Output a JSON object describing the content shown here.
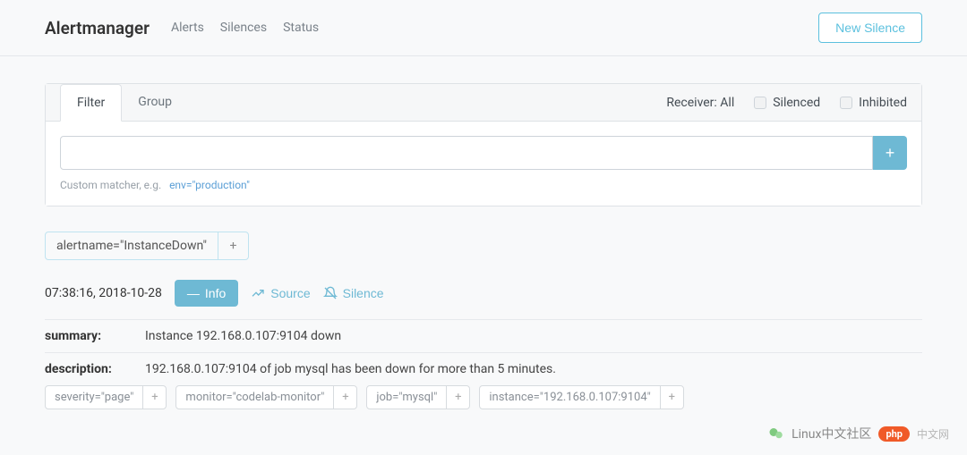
{
  "header": {
    "brand": "Alertmanager",
    "nav": {
      "alerts": "Alerts",
      "silences": "Silences",
      "status": "Status"
    },
    "new_silence": "New Silence"
  },
  "filter_card": {
    "tabs": {
      "filter": "Filter",
      "group": "Group"
    },
    "receiver_label": "Receiver: All",
    "checks": {
      "silenced": "Silenced",
      "inhibited": "Inhibited"
    },
    "input_value": "",
    "plus": "+",
    "hint_prefix": "Custom matcher, e.g.",
    "hint_example": "env=\"production\""
  },
  "active_filter_tag": {
    "text": "alertname=\"InstanceDown\"",
    "plus": "+"
  },
  "alert": {
    "timestamp": "07:38:16, 2018-10-28",
    "btn_info": "Info",
    "btn_source": "Source",
    "btn_silence": "Silence",
    "details": {
      "summary_label": "summary:",
      "summary_value": "Instance 192.168.0.107:9104 down",
      "description_label": "description:",
      "description_value": "192.168.0.107:9104 of job mysql has been down for more than 5 minutes."
    },
    "labels": [
      "severity=\"page\"",
      "monitor=\"codelab-monitor\"",
      "job=\"mysql\"",
      "instance=\"192.168.0.107:9104\""
    ],
    "label_plus": "+"
  },
  "watermark": {
    "line1": "Linux中文社区",
    "badge": "php",
    "line2": "中文网"
  }
}
